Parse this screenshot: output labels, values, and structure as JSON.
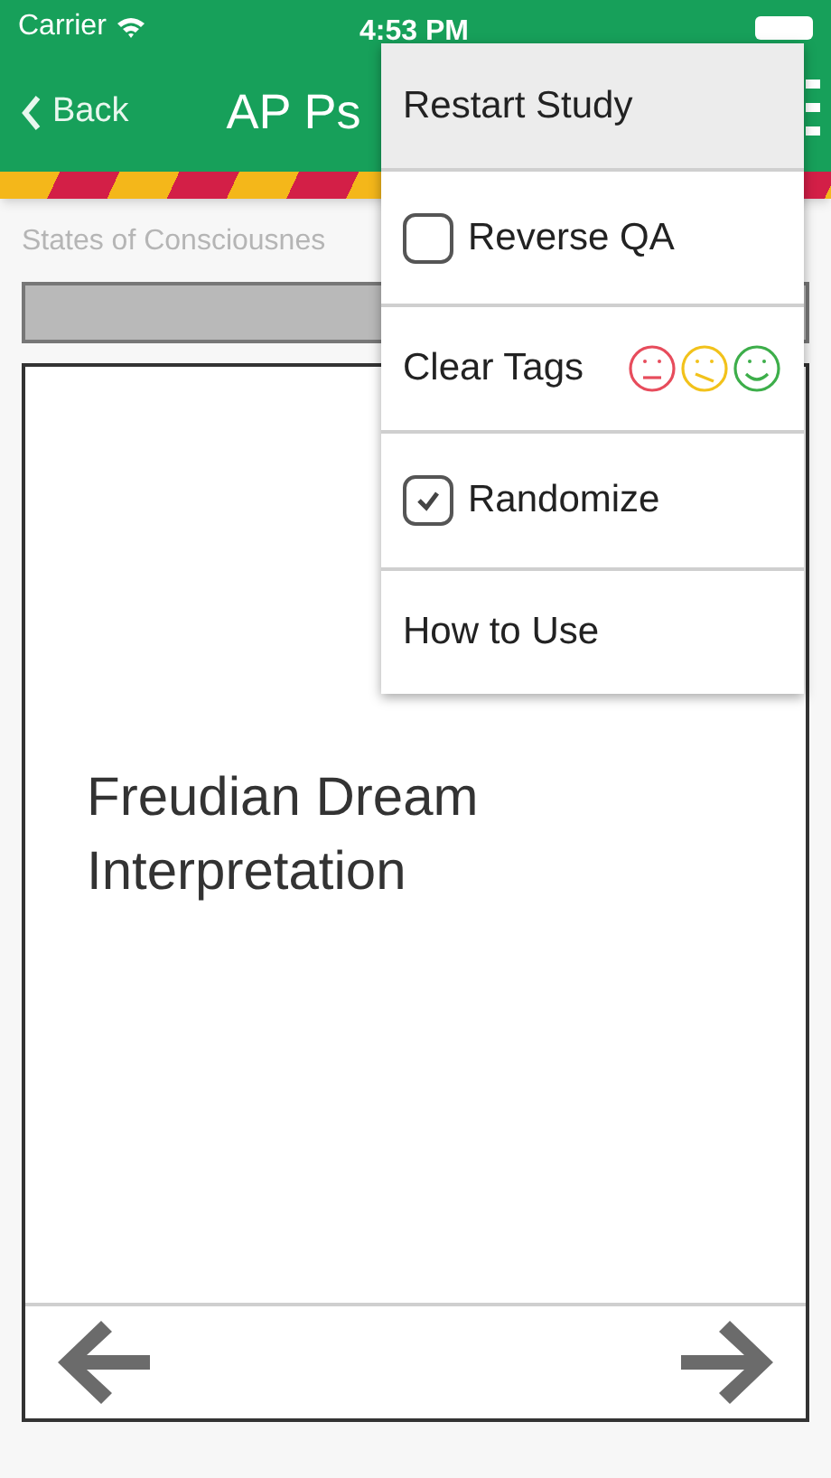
{
  "status_bar": {
    "carrier": "Carrier",
    "time": "4:53 PM"
  },
  "nav": {
    "back": "Back",
    "title": "AP Ps"
  },
  "subtitle": "States of Consciousnes",
  "card": {
    "text": "Freudian Dream Interpretation"
  },
  "menu": [
    {
      "kind": "plain",
      "label": "Restart Study",
      "selected": true
    },
    {
      "kind": "checkbox",
      "label": "Reverse QA",
      "checked": false,
      "selected": false
    },
    {
      "kind": "tags",
      "label": "Clear Tags",
      "selected": false
    },
    {
      "kind": "checkbox",
      "label": "Randomize",
      "checked": true,
      "selected": false
    },
    {
      "kind": "plain",
      "label": "How to Use",
      "selected": false
    }
  ]
}
